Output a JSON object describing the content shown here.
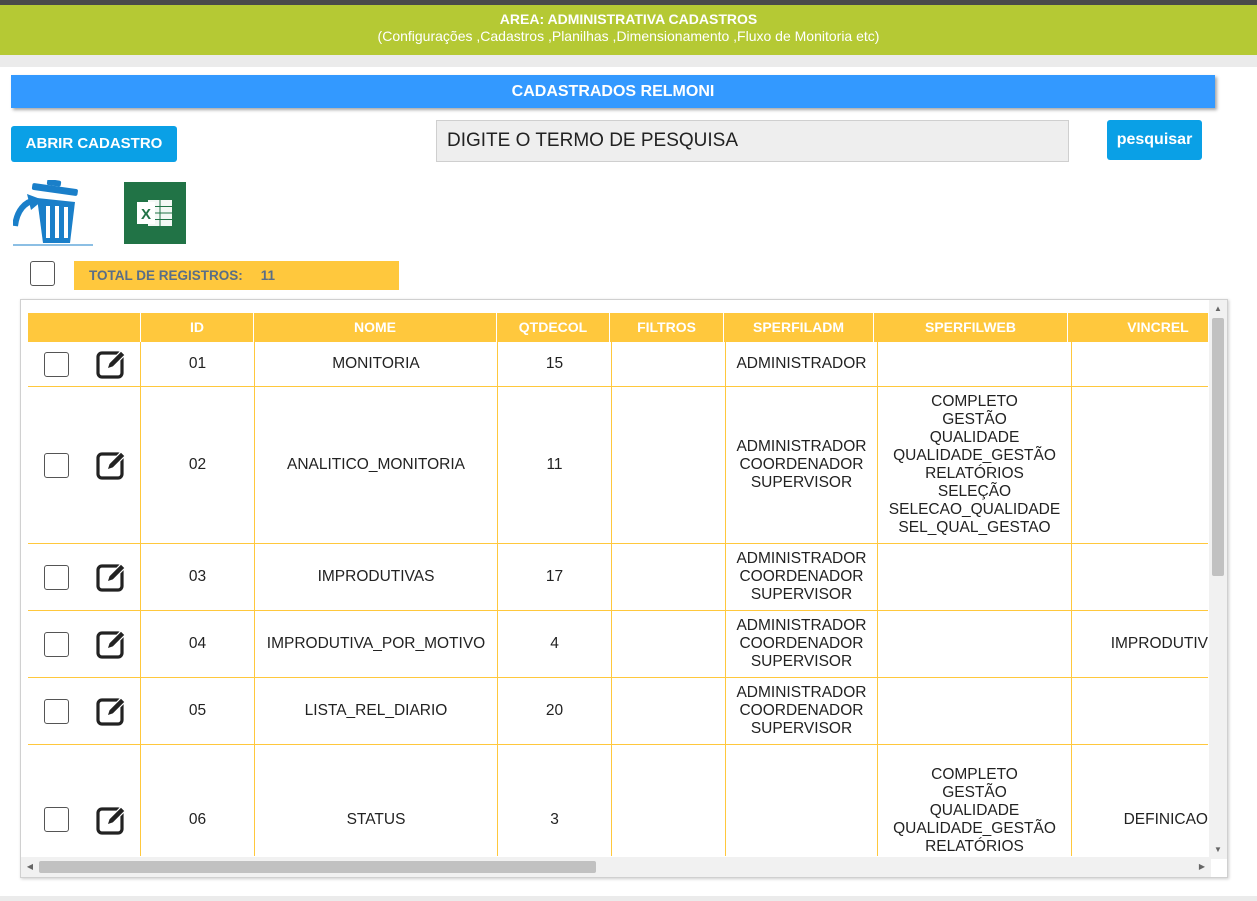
{
  "header": {
    "title": "AREA: ADMINISTRATIVA CADASTROS",
    "subtitle": "(Configurações ,Cadastros ,Planilhas ,Dimensionamento ,Fluxo de Monitoria etc)"
  },
  "section": {
    "title": "CADASTRADOS RELMONI"
  },
  "toolbar": {
    "open_label": "ABRIR CADASTRO",
    "search_value": "DIGITE O TERMO DE PESQUISA",
    "search_button": "pesquisar",
    "delete_icon": "trash-recycle-icon",
    "excel_icon": "excel-export-icon"
  },
  "total": {
    "label": "TOTAL DE REGISTROS:",
    "count": "11"
  },
  "colors": {
    "header_green": "#b5c934",
    "title_blue": "#3399ff",
    "button_blue": "#0aa0e6",
    "table_yellow": "#ffc83d"
  },
  "table": {
    "columns": [
      "ID",
      "NOME",
      "QTDECOL",
      "FILTROS",
      "SPERFILADM",
      "SPERFILWEB",
      "VINCREL"
    ],
    "rows": [
      {
        "id": "01",
        "nome": "MONITORIA",
        "qtdecol": "15",
        "filtros": "",
        "sperfiladm": "ADMINISTRADOR",
        "sperfilweb": "",
        "vincrel": ""
      },
      {
        "id": "02",
        "nome": "ANALITICO_MONITORIA",
        "qtdecol": "11",
        "filtros": "",
        "sperfiladm": "ADMINISTRADOR\nCOORDENADOR\nSUPERVISOR",
        "sperfilweb": "COMPLETO\nGESTÃO\nQUALIDADE\nQUALIDADE_GESTÃO\nRELATÓRIOS\nSELEÇÃO\nSELECAO_QUALIDADE\nSEL_QUAL_GESTAO",
        "vincrel": ""
      },
      {
        "id": "03",
        "nome": "IMPRODUTIVAS",
        "qtdecol": "17",
        "filtros": "",
        "sperfiladm": "ADMINISTRADOR\nCOORDENADOR\nSUPERVISOR",
        "sperfilweb": "",
        "vincrel": ""
      },
      {
        "id": "04",
        "nome": "IMPRODUTIVA_POR_MOTIVO",
        "qtdecol": "4",
        "filtros": "",
        "sperfiladm": "ADMINISTRADOR\nCOORDENADOR\nSUPERVISOR",
        "sperfilweb": "",
        "vincrel": "IMPRODUTIV"
      },
      {
        "id": "05",
        "nome": "LISTA_REL_DIARIO",
        "qtdecol": "20",
        "filtros": "",
        "sperfiladm": "ADMINISTRADOR\nCOORDENADOR\nSUPERVISOR",
        "sperfilweb": "",
        "vincrel": ""
      },
      {
        "id": "06",
        "nome": "STATUS",
        "qtdecol": "3",
        "filtros": "",
        "sperfiladm": "",
        "sperfilweb": "COMPLETO\nGESTÃO\nQUALIDADE\nQUALIDADE_GESTÃO\nRELATÓRIOS\nSELEÇÃO",
        "vincrel": "DEFINICAO"
      }
    ]
  }
}
